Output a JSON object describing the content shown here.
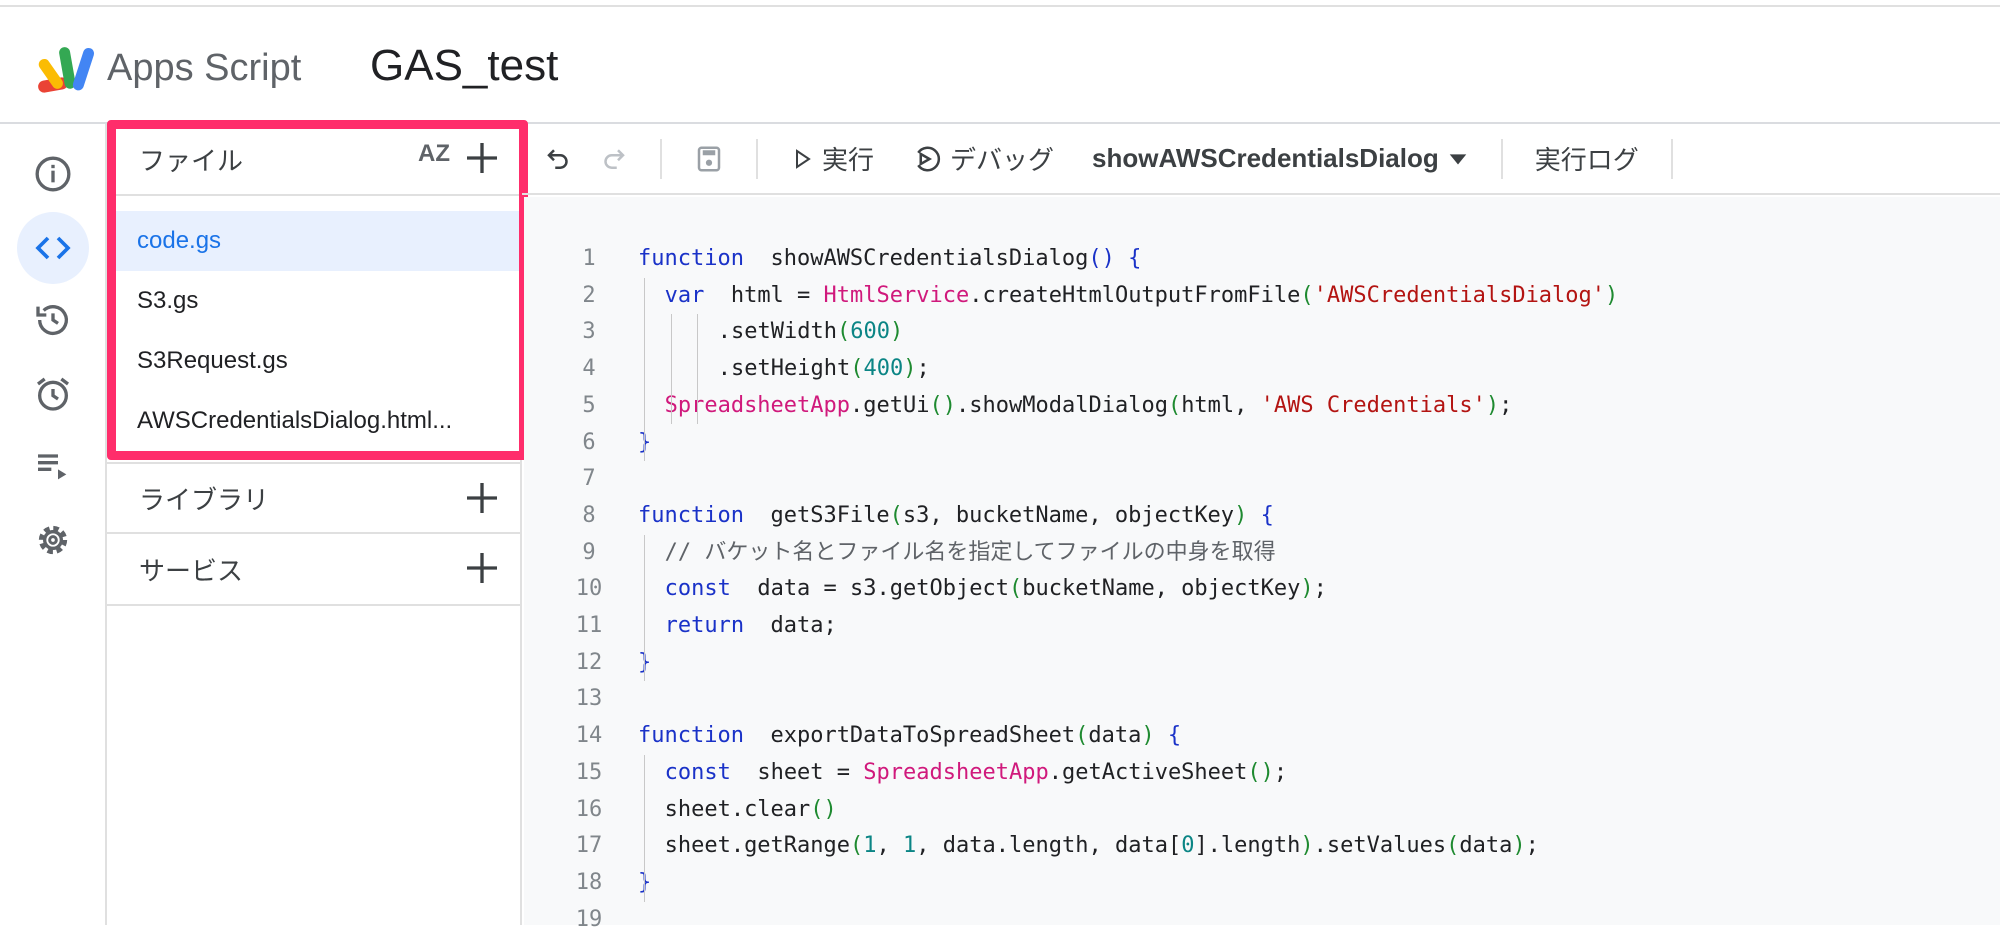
{
  "header": {
    "app_name": "Apps Script",
    "project_title": "GAS_test"
  },
  "rail": {
    "items": [
      {
        "name": "overview",
        "icon": "info-icon"
      },
      {
        "name": "editor",
        "icon": "code-icon",
        "active": true
      },
      {
        "name": "executions-history",
        "icon": "history-icon"
      },
      {
        "name": "triggers",
        "icon": "alarm-icon"
      },
      {
        "name": "executions",
        "icon": "playlist-play-icon"
      },
      {
        "name": "settings",
        "icon": "gear-icon"
      }
    ]
  },
  "files_panel": {
    "title": "ファイル",
    "sort_label": "AZ",
    "files": [
      {
        "label": "code.gs",
        "selected": true
      },
      {
        "label": "S3.gs"
      },
      {
        "label": "S3Request.gs"
      },
      {
        "label": "AWSCredentialsDialog.html..."
      }
    ],
    "libraries_label": "ライブラリ",
    "services_label": "サービス"
  },
  "toolbar": {
    "run_label": "実行",
    "debug_label": "デバッグ",
    "function_select": "showAWSCredentialsDialog",
    "log_label": "実行ログ"
  },
  "highlight_color": "#ff2d6b",
  "editor": {
    "lines": [
      {
        "n": "1",
        "indent": 0,
        "t": [
          [
            "kw",
            "function"
          ],
          [
            "",
            "showAWSCredentialsDialog"
          ],
          [
            "brc",
            "()"
          ],
          [
            "",
            ""
          ],
          [
            "brc",
            "{"
          ]
        ]
      },
      {
        "n": "2",
        "indent": 1,
        "t": [
          [
            "kw",
            "var"
          ],
          [
            "",
            "html = "
          ],
          [
            "cls",
            "HtmlService"
          ],
          [
            "",
            ".createHtmlOutputFromFile"
          ],
          [
            "par",
            "("
          ],
          [
            "str",
            "'AWSCredentialsDialog'"
          ],
          [
            "par",
            ")"
          ]
        ]
      },
      {
        "n": "3",
        "indent": 3,
        "t": [
          [
            "",
            ".setWidth"
          ],
          [
            "par",
            "("
          ],
          [
            "num",
            "600"
          ],
          [
            "par",
            ")"
          ]
        ]
      },
      {
        "n": "4",
        "indent": 3,
        "t": [
          [
            "",
            ".setHeight"
          ],
          [
            "par",
            "("
          ],
          [
            "num",
            "400"
          ],
          [
            "par",
            ")"
          ],
          [
            "",
            ";"
          ]
        ]
      },
      {
        "n": "5",
        "indent": 1,
        "t": [
          [
            "cls",
            "SpreadsheetApp"
          ],
          [
            "",
            ".getUi"
          ],
          [
            "par",
            "()"
          ],
          [
            "",
            ".showModalDialog"
          ],
          [
            "par",
            "("
          ],
          [
            "",
            "html, "
          ],
          [
            "str",
            "'AWS Credentials'"
          ],
          [
            "par",
            ")"
          ],
          [
            "",
            ";"
          ]
        ]
      },
      {
        "n": "6",
        "indent": 0,
        "t": [
          [
            "brc",
            "}"
          ]
        ]
      },
      {
        "n": "7",
        "indent": 0,
        "t": []
      },
      {
        "n": "8",
        "indent": 0,
        "t": [
          [
            "kw",
            "function"
          ],
          [
            "",
            "getS3File"
          ],
          [
            "par",
            "("
          ],
          [
            "",
            "s3, bucketName, objectKey"
          ],
          [
            "par",
            ")"
          ],
          [
            "",
            ""
          ],
          [
            "brc",
            "{"
          ]
        ]
      },
      {
        "n": "9",
        "indent": 1,
        "t": [
          [
            "cmt",
            "// バケット名とファイル名を指定してファイルの中身を取得"
          ]
        ]
      },
      {
        "n": "10",
        "indent": 1,
        "t": [
          [
            "kw",
            "const"
          ],
          [
            "",
            "data = s3.getObject"
          ],
          [
            "par",
            "("
          ],
          [
            "",
            "bucketName, objectKey"
          ],
          [
            "par",
            ")"
          ],
          [
            "",
            ";"
          ]
        ]
      },
      {
        "n": "11",
        "indent": 1,
        "t": [
          [
            "kw",
            "return"
          ],
          [
            "",
            "data;"
          ]
        ]
      },
      {
        "n": "12",
        "indent": 0,
        "t": [
          [
            "brc",
            "}"
          ]
        ]
      },
      {
        "n": "13",
        "indent": 0,
        "t": []
      },
      {
        "n": "14",
        "indent": 0,
        "t": [
          [
            "kw",
            "function"
          ],
          [
            "",
            "exportDataToSpreadSheet"
          ],
          [
            "par",
            "("
          ],
          [
            "",
            "data"
          ],
          [
            "par",
            ")"
          ],
          [
            "",
            ""
          ],
          [
            "brc",
            "{"
          ]
        ]
      },
      {
        "n": "15",
        "indent": 1,
        "t": [
          [
            "kw",
            "const"
          ],
          [
            "",
            "sheet = "
          ],
          [
            "cls",
            "SpreadsheetApp"
          ],
          [
            "",
            ".getActiveSheet"
          ],
          [
            "par",
            "()"
          ],
          [
            "",
            ";"
          ]
        ]
      },
      {
        "n": "16",
        "indent": 1,
        "t": [
          [
            "",
            "sheet.clear"
          ],
          [
            "par",
            "()"
          ]
        ]
      },
      {
        "n": "17",
        "indent": 1,
        "t": [
          [
            "",
            "sheet.getRange"
          ],
          [
            "par",
            "("
          ],
          [
            "num",
            "1"
          ],
          [
            "",
            ", "
          ],
          [
            "num",
            "1"
          ],
          [
            "",
            ", data.length, data["
          ],
          [
            "num",
            "0"
          ],
          [
            "",
            "].length"
          ],
          [
            "par",
            ")"
          ],
          [
            "",
            ".setValues"
          ],
          [
            "par",
            "("
          ],
          [
            "",
            "data"
          ],
          [
            "par",
            ")"
          ],
          [
            "",
            ";"
          ]
        ]
      },
      {
        "n": "18",
        "indent": 0,
        "t": [
          [
            "brc",
            "}"
          ]
        ]
      },
      {
        "n": "19",
        "indent": 0,
        "t": []
      }
    ]
  }
}
